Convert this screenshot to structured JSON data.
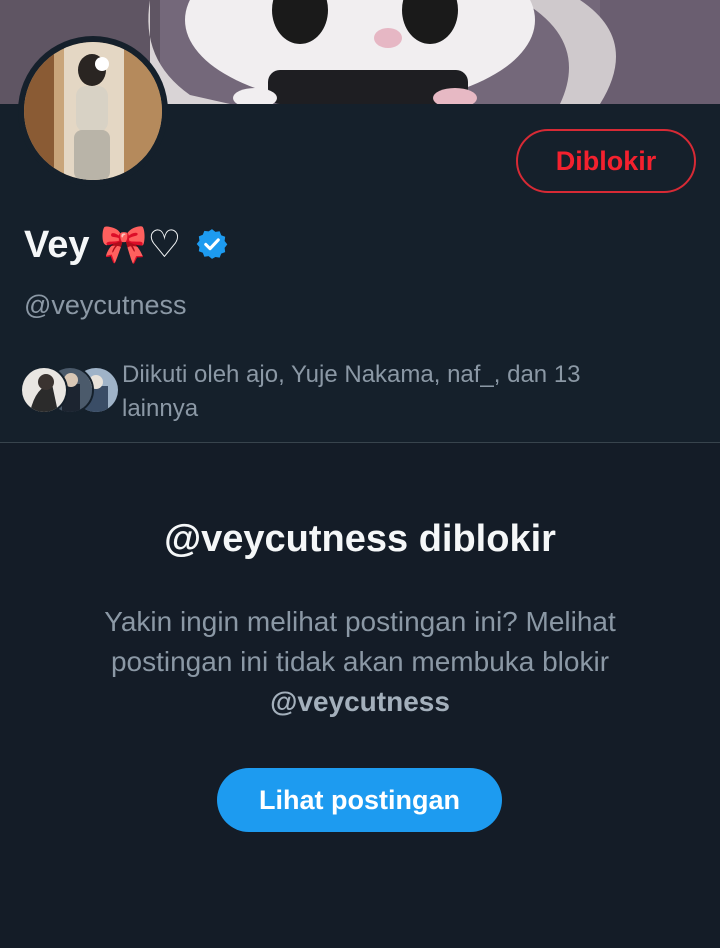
{
  "profile": {
    "display_name": "Vey 🎀♡",
    "handle": "@veycutness",
    "verified": true,
    "blocked_button_label": "Diblokir"
  },
  "followers": {
    "followed_by_text": "Diikuti oleh ajo, Yuje Nakama, naf_, dan 13 lainnya"
  },
  "blocked_notice": {
    "title": "@veycutness diblokir",
    "message_prefix": "Yakin ingin melihat postingan ini? Melihat postingan ini tidak akan membuka blokir",
    "message_handle": "@veycutness",
    "view_posts_label": "Lihat postingan"
  },
  "colors": {
    "background": "#15202b",
    "accent_blue": "#1d9bf0",
    "blocked_red": "#f4212e",
    "secondary_text": "#8b98a5"
  },
  "icons": {
    "verified": "verified-badge-icon"
  }
}
